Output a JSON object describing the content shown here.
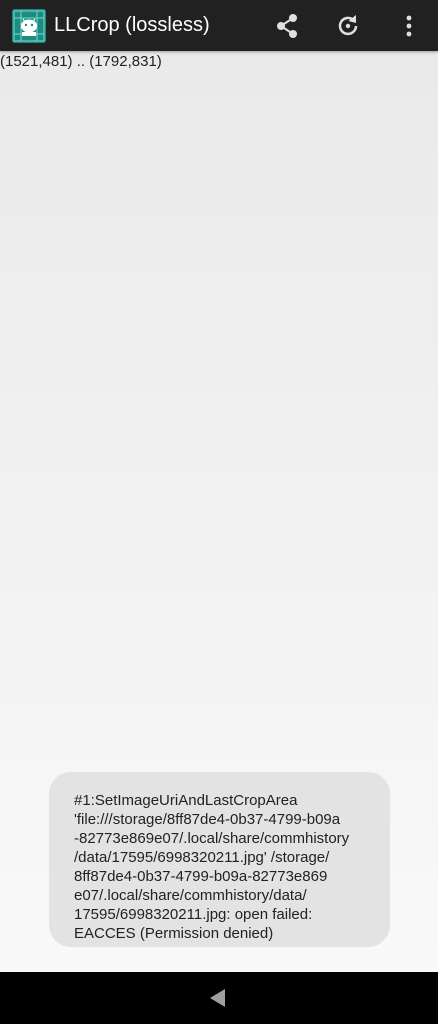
{
  "appbar": {
    "title": "LLCrop (lossless)",
    "icon": "llcrop-app-icon",
    "actions": [
      {
        "name": "share",
        "icon": "share-icon"
      },
      {
        "name": "rotate",
        "icon": "rotate-icon"
      },
      {
        "name": "overflow-menu",
        "icon": "more-vertical-icon"
      }
    ],
    "background_color": "#212121",
    "icon_color": "#1b8c82"
  },
  "crop": {
    "coords_text": "(1521,481) .. (1792,831)"
  },
  "toast": {
    "lines": [
      "#1:SetImageUriAndLastCropArea",
      "'file:///storage/8ff87de4-0b37-4799-b09a",
      "-82773e869e07/.local/share/commhistory",
      "/data/17595/6998320211.jpg' /storage/",
      "8ff87de4-0b37-4799-b09a-82773e869",
      "e07/.local/share/commhistory/data/",
      "17595/6998320211.jpg: open failed:",
      "EACCES (Permission denied)"
    ]
  },
  "navbar": {
    "back_icon": "back-triangle-icon"
  }
}
